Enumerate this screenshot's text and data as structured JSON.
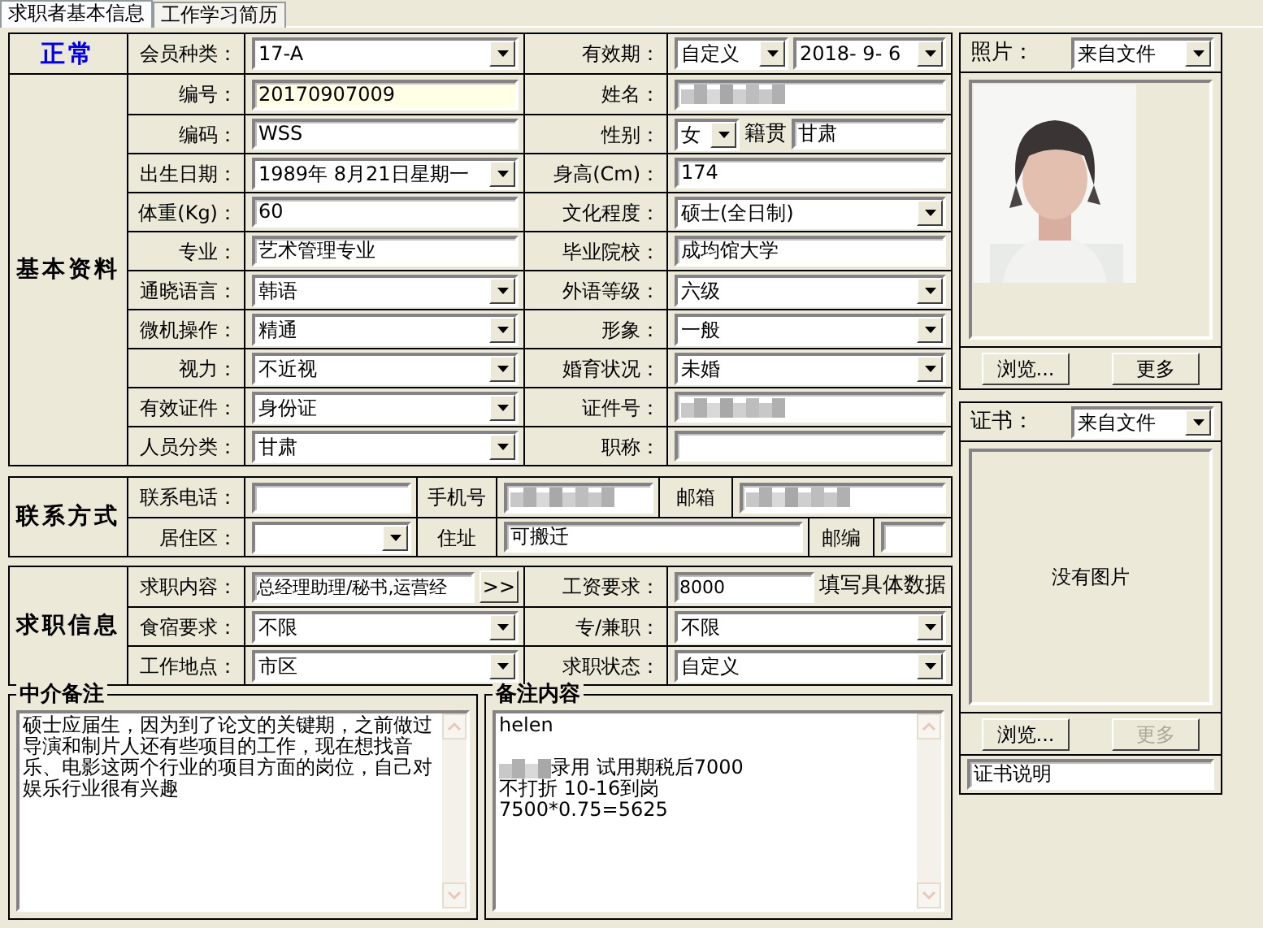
{
  "tabs": [
    {
      "label": "求职者基本信息",
      "selected": true
    },
    {
      "label": "工作学习简历",
      "selected": false
    }
  ],
  "sections": [
    {
      "kind": "status",
      "heading": "正常",
      "rows": [
        {
          "cells": [
            {
              "label": "会员种类："
            },
            {
              "controls": [
                {
                  "kind": "combo",
                  "value": "17-A"
                }
              ]
            },
            {
              "label": "有效期："
            },
            {
              "controls": [
                {
                  "kind": "combo",
                  "value": "自定义"
                },
                {
                  "kind": "combo",
                  "value": "2018- 9- 6"
                }
              ]
            }
          ]
        }
      ]
    },
    {
      "kind": "basic",
      "heading": "基本资料",
      "rows": [
        {
          "cells": [
            {
              "label": "编号："
            },
            {
              "controls": [
                {
                  "kind": "highlight",
                  "value": "20170907009"
                }
              ]
            },
            {
              "label": "姓名："
            },
            {
              "controls": [
                {
                  "kind": "redacted"
                }
              ]
            }
          ]
        },
        {
          "cells": [
            {
              "label": "编码："
            },
            {
              "controls": [
                {
                  "kind": "text",
                  "value": "WSS"
                }
              ]
            },
            {
              "label": "性别："
            },
            {
              "controls": [
                {
                  "kind": "short_combo",
                  "value": "女"
                },
                {
                  "kind": "caption",
                  "value": "籍贯"
                },
                {
                  "kind": "text",
                  "value": "甘肃"
                }
              ]
            }
          ]
        },
        {
          "cells": [
            {
              "label": "出生日期："
            },
            {
              "controls": [
                {
                  "kind": "combo",
                  "value": "1989年 8月21日星期一"
                }
              ]
            },
            {
              "label": "身高(Cm)："
            },
            {
              "controls": [
                {
                  "kind": "text",
                  "value": "174"
                }
              ]
            }
          ]
        },
        {
          "cells": [
            {
              "label": "体重(Kg)："
            },
            {
              "controls": [
                {
                  "kind": "text",
                  "value": "60"
                }
              ]
            },
            {
              "label": "文化程度："
            },
            {
              "controls": [
                {
                  "kind": "combo",
                  "value": "硕士(全日制)"
                }
              ]
            }
          ]
        },
        {
          "cells": [
            {
              "label": "专业："
            },
            {
              "controls": [
                {
                  "kind": "text",
                  "value": "艺术管理专业"
                }
              ]
            },
            {
              "label": "毕业院校："
            },
            {
              "controls": [
                {
                  "kind": "text",
                  "value": "成均馆大学"
                }
              ]
            }
          ]
        },
        {
          "cells": [
            {
              "label": "通晓语言："
            },
            {
              "controls": [
                {
                  "kind": "combo",
                  "value": "韩语"
                }
              ]
            },
            {
              "label": "外语等级："
            },
            {
              "controls": [
                {
                  "kind": "combo",
                  "value": "六级"
                }
              ]
            }
          ]
        },
        {
          "cells": [
            {
              "label": "微机操作："
            },
            {
              "controls": [
                {
                  "kind": "combo",
                  "value": "精通"
                }
              ]
            },
            {
              "label": "形象："
            },
            {
              "controls": [
                {
                  "kind": "combo",
                  "value": "一般"
                }
              ]
            }
          ]
        },
        {
          "cells": [
            {
              "label": "视力："
            },
            {
              "controls": [
                {
                  "kind": "combo",
                  "value": "不近视"
                }
              ]
            },
            {
              "label": "婚育状况："
            },
            {
              "controls": [
                {
                  "kind": "combo",
                  "value": "未婚"
                }
              ]
            }
          ]
        },
        {
          "cells": [
            {
              "label": "有效证件："
            },
            {
              "controls": [
                {
                  "kind": "combo",
                  "value": "身份证"
                }
              ]
            },
            {
              "label": "证件号："
            },
            {
              "controls": [
                {
                  "kind": "redacted"
                }
              ]
            }
          ]
        },
        {
          "cells": [
            {
              "label": "人员分类："
            },
            {
              "controls": [
                {
                  "kind": "combo",
                  "value": "甘肃"
                }
              ]
            },
            {
              "label": "职称："
            },
            {
              "controls": [
                {
                  "kind": "text"
                }
              ]
            }
          ]
        }
      ]
    },
    {
      "kind": "contact",
      "heading": "联系方式",
      "rows": [
        {
          "cells": [
            {
              "label": "联系电话："
            },
            {
              "controls": [
                {
                  "kind": "text"
                }
              ]
            },
            {
              "label": "手机号"
            },
            {
              "controls": [
                {
                  "kind": "redacted"
                }
              ]
            },
            {
              "label": "邮箱"
            },
            {
              "controls": [
                {
                  "kind": "redacted"
                }
              ]
            }
          ]
        },
        {
          "cells": [
            {
              "label": "居住区："
            },
            {
              "controls": [
                {
                  "kind": "combo"
                }
              ]
            },
            {
              "label": "住址"
            },
            {
              "controls": [
                {
                  "kind": "text",
                  "value": "可搬迁"
                }
              ]
            },
            {
              "label": "邮编"
            },
            {
              "controls": [
                {
                  "kind": "text"
                }
              ]
            }
          ]
        }
      ]
    },
    {
      "kind": "job",
      "heading": "求职信息",
      "rows": [
        {
          "cells": [
            {
              "label": "求职内容："
            },
            {
              "controls": [
                {
                  "kind": "text",
                  "value": "总经理助理/秘书,运营经"
                },
                {
                  "kind": "button",
                  "value": ">>"
                }
              ]
            },
            {
              "label": "工资要求："
            },
            {
              "controls": [
                {
                  "kind": "text",
                  "value": "8000"
                },
                {
                  "kind": "caption",
                  "value": "填写具体数据"
                }
              ]
            }
          ]
        },
        {
          "cells": [
            {
              "label": "食宿要求："
            },
            {
              "controls": [
                {
                  "kind": "combo",
                  "value": "不限"
                }
              ]
            },
            {
              "label": "专/兼职："
            },
            {
              "controls": [
                {
                  "kind": "combo",
                  "value": "不限"
                }
              ]
            }
          ]
        },
        {
          "cells": [
            {
              "label": "工作地点："
            },
            {
              "controls": [
                {
                  "kind": "combo",
                  "value": "市区"
                }
              ]
            },
            {
              "label": "求职状态："
            },
            {
              "controls": [
                {
                  "kind": "combo",
                  "value": "自定义"
                }
              ]
            }
          ]
        }
      ]
    }
  ],
  "notes": [
    {
      "title": "中介备注",
      "kind": "paragraph",
      "text": "硕士应届生，因为到了论文的关键期，之前做过导演和制片人还有些项目的工作，现在想找音乐、电影这两个行业的项目方面的岗位，自己对娱乐行业很有兴趣"
    },
    {
      "title": "备注内容",
      "kind": "lines",
      "lines": [
        {
          "text": "helen",
          "gap_before": false,
          "redacted_prefix": false
        },
        {
          "text": "录用   试用期税后7000",
          "gap_before": true,
          "redacted_prefix": true
        },
        {
          "text": "不打折  10-16到岗",
          "gap_before": false,
          "redacted_prefix": false
        },
        {
          "text": "7500*0.75=5625",
          "gap_before": false,
          "redacted_prefix": false
        }
      ]
    }
  ],
  "panels": [
    {
      "label": "照片：",
      "source": "来自文件",
      "buttons": [
        {
          "label": "浏览...",
          "disabled": false
        },
        {
          "label": "更多",
          "disabled": false
        }
      ]
    },
    {
      "kind": "certificate",
      "label": "证书：",
      "source": "来自文件",
      "empty_text": "没有图片",
      "buttons": [
        {
          "label": "浏览...",
          "disabled": false
        },
        {
          "label": "更多",
          "disabled": true
        }
      ],
      "caption_value": "证书说明"
    }
  ]
}
